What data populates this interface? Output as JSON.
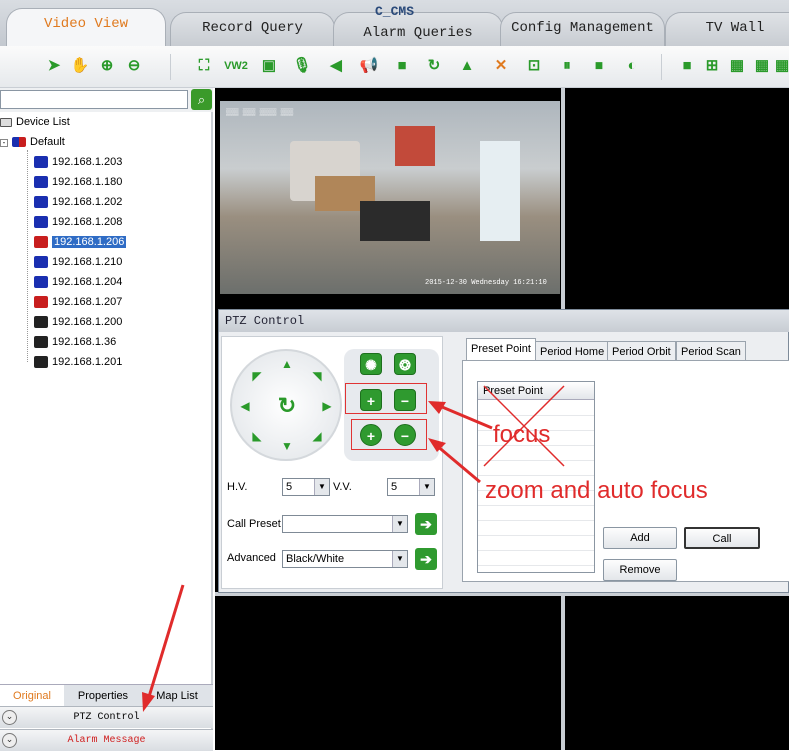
{
  "app": {
    "title": "C_CMS"
  },
  "tabs": [
    {
      "label": "Video View",
      "active": true
    },
    {
      "label": "Record Query",
      "active": false
    },
    {
      "label": "Alarm Queries",
      "active": false
    },
    {
      "label": "Config Management",
      "active": false
    },
    {
      "label": "TV Wall",
      "active": false
    }
  ],
  "toolbar_icons": [
    "pointer-icon",
    "hand-icon",
    "zoom-in-icon",
    "zoom-out-icon",
    "fullscreen-icon",
    "vw2-icon",
    "image-icon",
    "microphone-icon",
    "speaker-icon",
    "broadcast-icon",
    "record-icon",
    "refresh-icon",
    "alarm-bell-icon",
    "shrink-icon",
    "lock-icon",
    "pause-icon",
    "stop-icon",
    "close-circle-icon",
    "layout-1-icon",
    "layout-4-icon",
    "layout-9-icon",
    "layout-16-icon",
    "layout-more-icon"
  ],
  "toolbar": {
    "vw2_label": "VW2"
  },
  "device_tree": {
    "root": "Device List",
    "group": "Default",
    "devices": [
      {
        "ip": "192.168.1.203",
        "status_color": "#1a2fb0"
      },
      {
        "ip": "192.168.1.180",
        "status_color": "#1a2fb0"
      },
      {
        "ip": "192.168.1.202",
        "status_color": "#1a2fb0"
      },
      {
        "ip": "192.168.1.208",
        "status_color": "#1a2fb0"
      },
      {
        "ip": "192.168.1.206",
        "status_color": "#c81e1e",
        "selected": true
      },
      {
        "ip": "192.168.1.210",
        "status_color": "#1a2fb0"
      },
      {
        "ip": "192.168.1.204",
        "status_color": "#1a2fb0"
      },
      {
        "ip": "192.168.1.207",
        "status_color": "#c81e1e"
      },
      {
        "ip": "192.168.1.200",
        "status_color": "#222222"
      },
      {
        "ip": "192.168.1.36",
        "status_color": "#222222"
      },
      {
        "ip": "192.168.1.201",
        "status_color": "#222222"
      }
    ]
  },
  "bottom_tabs": [
    {
      "label": "Original",
      "active": true
    },
    {
      "label": "Properties",
      "active": false
    },
    {
      "label": "Map List",
      "active": false
    }
  ],
  "accordion": {
    "ptz": "PTZ Control",
    "alarm": "Alarm Message"
  },
  "video": {
    "osd_timestamp": "2015-12-30 Wednesday 16:21:10"
  },
  "ptz": {
    "title": "PTZ Control",
    "hv_label": "H.V.",
    "hv_value": "5",
    "vv_label": "V.V.",
    "vv_value": "5",
    "call_preset_label": "Call Preset",
    "call_preset_value": "",
    "advanced_label": "Advanced",
    "advanced_value": "Black/White",
    "tabs": [
      "Preset Point",
      "Period Home",
      "Period Orbit",
      "Period Scan"
    ],
    "preset_header": "Preset Point",
    "add_label": "Add",
    "call_label": "Call",
    "remove_label": "Remove"
  },
  "annotations": {
    "focus": "focus",
    "zoom": "zoom and auto focus"
  },
  "colors": {
    "accent_green": "#2f9a2f",
    "active_tab_text": "#e07a1f",
    "annotation_red": "#e02b2b",
    "selection_blue": "#2f6cc5"
  }
}
